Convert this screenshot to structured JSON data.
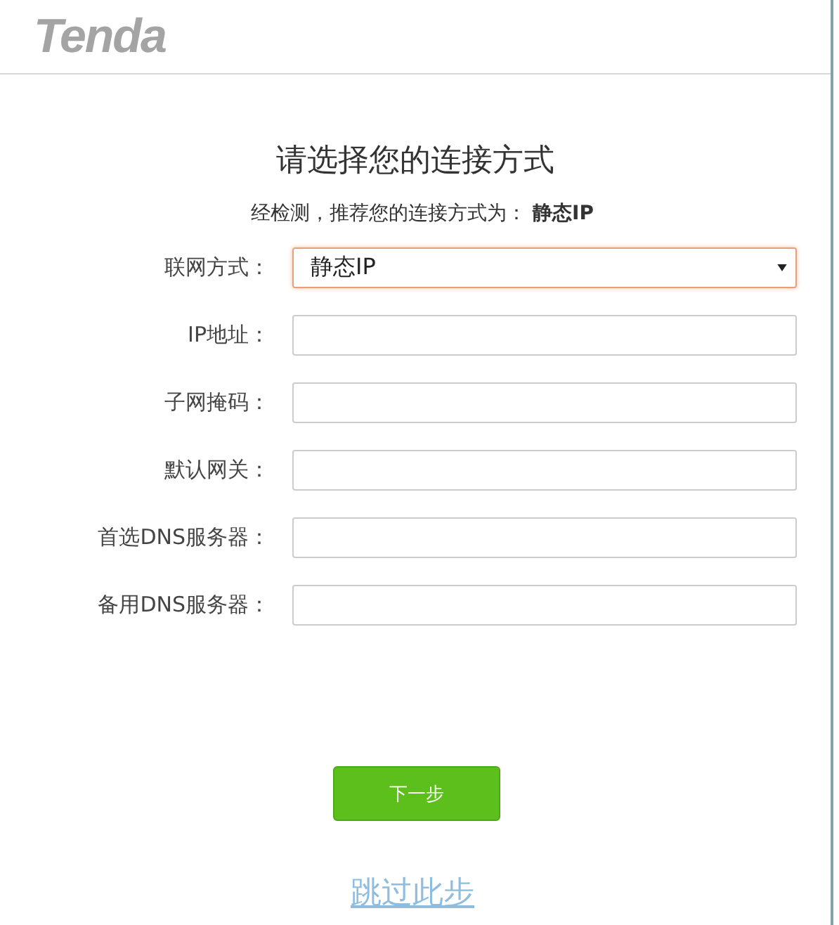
{
  "logo": "Tenda",
  "title": "请选择您的连接方式",
  "recommendation": "经检测，推荐您的连接方式为： **静态IP**",
  "fields": [
    {
      "kind": "select",
      "label": "联网方式：",
      "value": "静态IP",
      "focused": true
    },
    {
      "kind": "text",
      "label": "IP地址：",
      "focused": false
    },
    {
      "kind": "text",
      "label": "子网掩码：",
      "focused": false
    },
    {
      "kind": "text",
      "label": "默认网关：",
      "focused": false
    },
    {
      "kind": "text",
      "label": "首选DNS服务器：",
      "focused": false
    },
    {
      "kind": "text",
      "label": "备用DNS服务器：",
      "focused": false
    }
  ],
  "next_button": "下一步",
  "skip_link": "跳过此步"
}
